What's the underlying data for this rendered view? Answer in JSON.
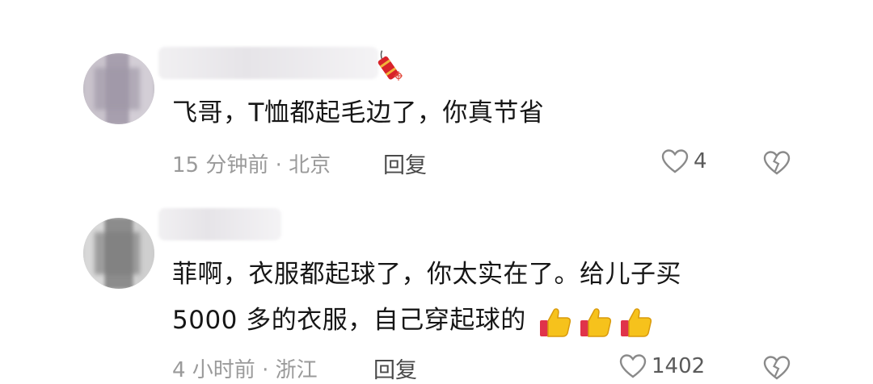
{
  "comments": [
    {
      "text": "飞哥，T恤都起毛边了，你真节省",
      "time": "15 分钟前",
      "location": "北京",
      "reply_label": "回复",
      "likes": "4"
    },
    {
      "text_line1": "菲啊，衣服都起球了，你太实在了。给儿子买",
      "text_line2": "5000 多的衣服，自己穿起球的",
      "time": "4 小时前",
      "location": "浙江",
      "reply_label": "回复",
      "likes": "1402"
    }
  ],
  "meta_separator": " · ",
  "icons": {
    "badge": "firecracker-icon",
    "like": "heart-outline-icon",
    "dislike": "broken-heart-icon",
    "reaction": "thumbs-up-icon"
  },
  "colors": {
    "background": "#ffffff",
    "text": "#161616",
    "meta": "#9a9a9a",
    "icon": "#8a8a8a",
    "thumb": "#f6c21c",
    "cuff": "#e0334a"
  }
}
